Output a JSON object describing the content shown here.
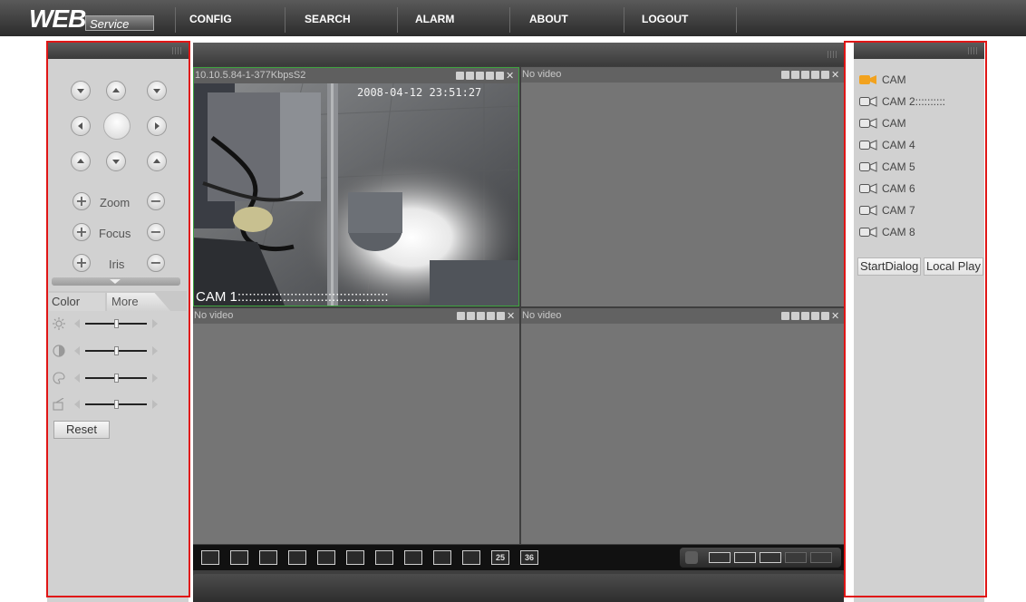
{
  "logo": {
    "web": "WEB",
    "service": "Service"
  },
  "nav": [
    {
      "label": "CONFIG"
    },
    {
      "label": "SEARCH"
    },
    {
      "label": "ALARM"
    },
    {
      "label": "ABOUT"
    },
    {
      "label": "LOGOUT"
    }
  ],
  "ptz": {
    "zoom_label": "Zoom",
    "focus_label": "Focus",
    "iris_label": "Iris",
    "plus_symbol": "+",
    "minus_symbol": "−"
  },
  "color_tabs": [
    {
      "label": "Color"
    },
    {
      "label": "More"
    }
  ],
  "color_sliders": [
    {
      "icon": "brightness-icon",
      "value": 0.5
    },
    {
      "icon": "contrast-icon",
      "value": 0.5
    },
    {
      "icon": "saturation-icon",
      "value": 0.5
    },
    {
      "icon": "hue-icon",
      "value": 0.5
    }
  ],
  "reset_label": "Reset",
  "video_cells": [
    {
      "header": "10.10.5.84-1-377KbpsS2",
      "timestamp": "2008-04-12 23:51:27",
      "overlay_name": "CAM 1::::::::::::::::::::::::::::::::::::::::",
      "active": true
    },
    {
      "header": "No video"
    },
    {
      "header": "No video"
    },
    {
      "header": "No video"
    }
  ],
  "toolbar_buttons": [
    "",
    "",
    "",
    "",
    "",
    "",
    "",
    "",
    "",
    "",
    "25",
    "36"
  ],
  "cameras": [
    {
      "label": "CAM",
      "active": true
    },
    {
      "label": "CAM 2::::::::::",
      "active": false
    },
    {
      "label": "CAM",
      "active": false
    },
    {
      "label": "CAM 4",
      "active": false
    },
    {
      "label": "CAM 5",
      "active": false
    },
    {
      "label": "CAM 6",
      "active": false
    },
    {
      "label": "CAM 7",
      "active": false
    },
    {
      "label": "CAM 8",
      "active": false
    }
  ],
  "start_dialog_label": "StartDialog",
  "local_play_label": "Local Play",
  "colors": {
    "highlight_border": "#e01616",
    "active_cam": "#f2a21e",
    "active_cell_border": "#3fa33f"
  }
}
